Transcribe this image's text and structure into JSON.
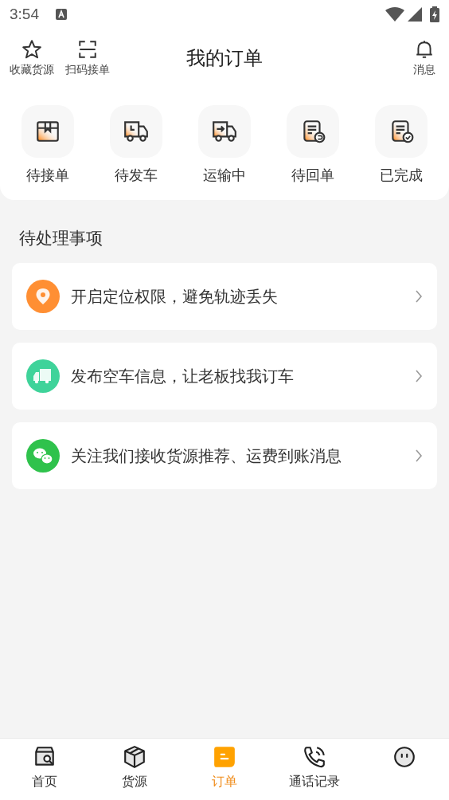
{
  "status_bar": {
    "time": "3:54"
  },
  "header": {
    "title": "我的订单",
    "left_actions": [
      {
        "label": "收藏货源"
      },
      {
        "label": "扫码接单"
      }
    ],
    "right_action": {
      "label": "消息"
    }
  },
  "order_states": [
    {
      "label": "待接单",
      "kind": "box"
    },
    {
      "label": "待发车",
      "kind": "truck-clock"
    },
    {
      "label": "运输中",
      "kind": "truck-arrow"
    },
    {
      "label": "待回单",
      "kind": "doc-return"
    },
    {
      "label": "已完成",
      "kind": "doc-check"
    }
  ],
  "pending": {
    "title": "待处理事项",
    "items": [
      {
        "text": "开启定位权限，避免轨迹丢失",
        "kind": "location",
        "color": "#ff8f33"
      },
      {
        "text": "发布空车信息，让老板找我订车",
        "kind": "truck",
        "color": "#3fd39a"
      },
      {
        "text": "关注我们接收货源推荐、运费到账消息",
        "kind": "chat",
        "color": "#2fc24c"
      }
    ]
  },
  "tab_bar": [
    {
      "label": "首页",
      "kind": "home",
      "selected": false
    },
    {
      "label": "货源",
      "kind": "cargo",
      "selected": false
    },
    {
      "label": "订单",
      "kind": "order",
      "selected": true
    },
    {
      "label": "通话记录",
      "kind": "phone",
      "selected": false
    },
    {
      "kind": "face",
      "selected": false
    }
  ]
}
